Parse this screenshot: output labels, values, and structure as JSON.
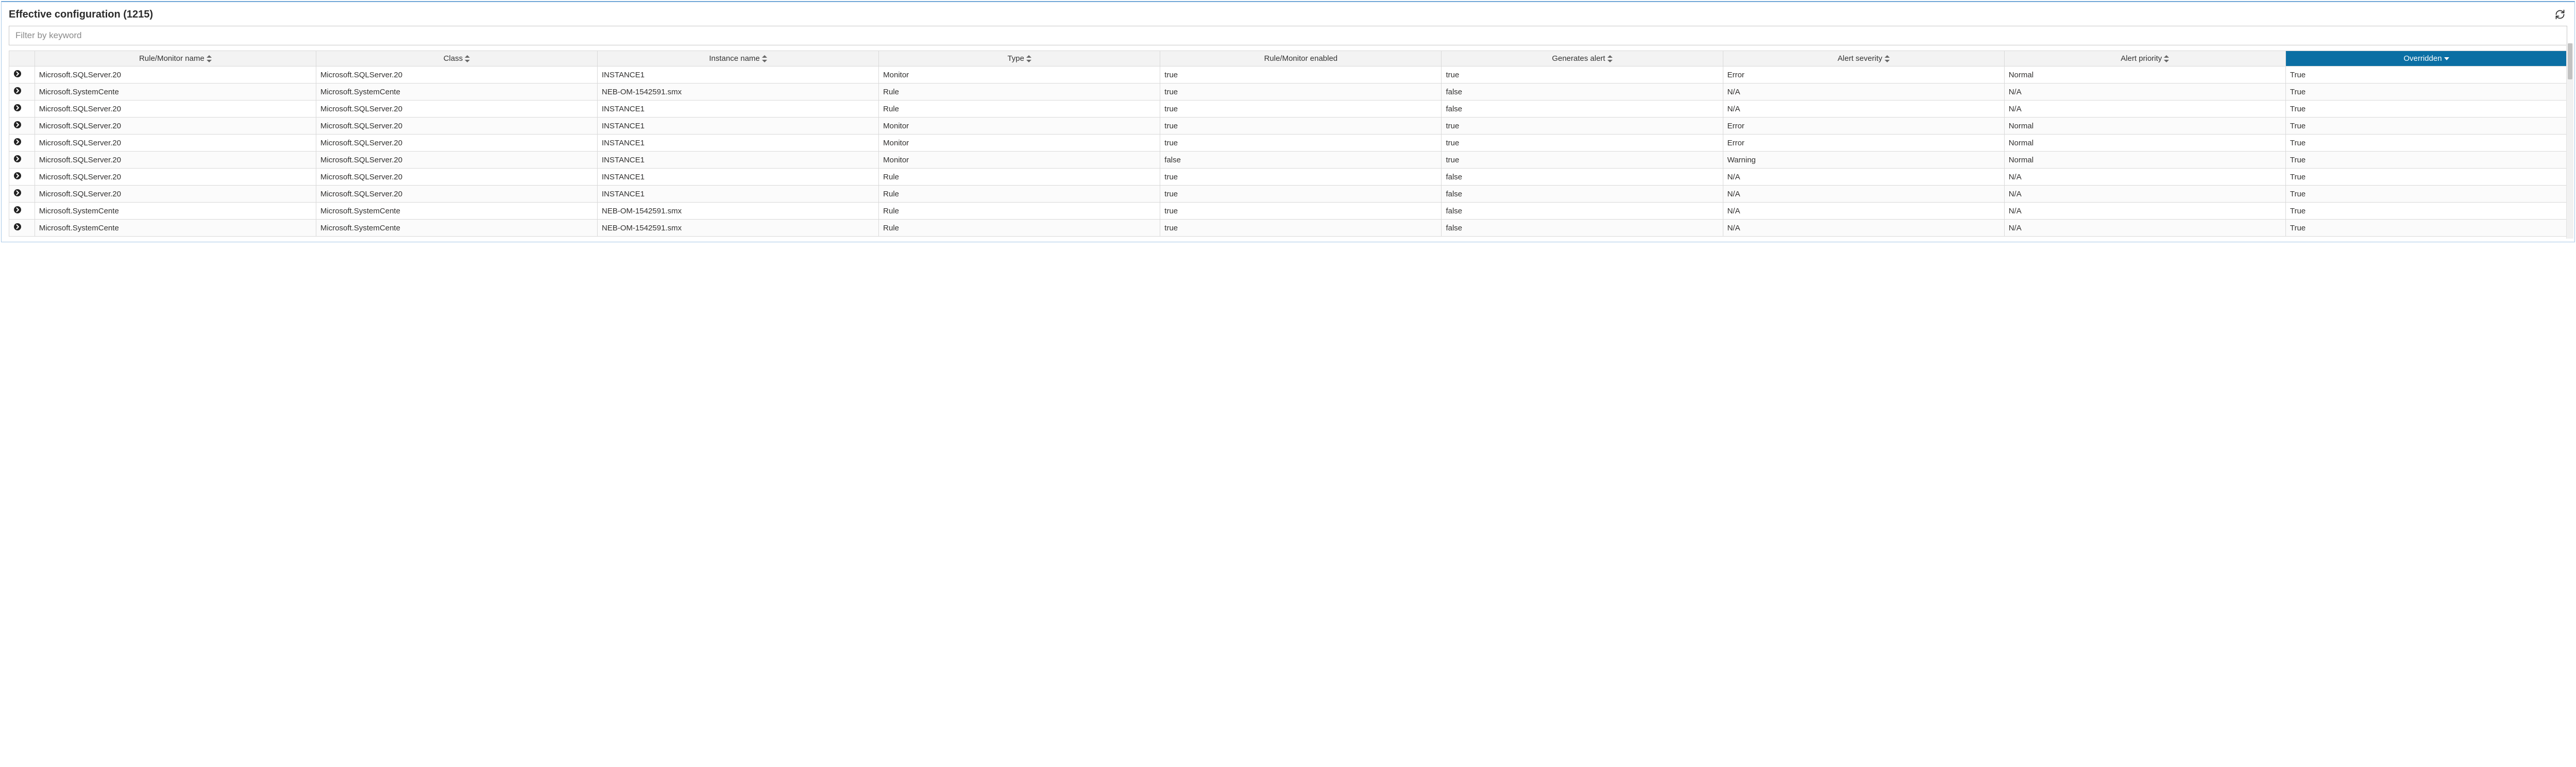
{
  "header": {
    "title": "Effective configuration (1215)"
  },
  "filter": {
    "placeholder": "Filter by keyword",
    "value": ""
  },
  "columns": [
    {
      "label": "",
      "sortable": false
    },
    {
      "label": "Rule/Monitor name",
      "sortable": true
    },
    {
      "label": "Class",
      "sortable": true
    },
    {
      "label": "Instance name",
      "sortable": true
    },
    {
      "label": "Type",
      "sortable": true
    },
    {
      "label": "Rule/Monitor enabled",
      "sortable": false
    },
    {
      "label": "Generates alert",
      "sortable": true
    },
    {
      "label": "Alert severity",
      "sortable": true
    },
    {
      "label": "Alert priority",
      "sortable": true
    },
    {
      "label": "Overridden",
      "sortable": true,
      "sorted": "desc"
    }
  ],
  "rows": [
    {
      "name": "Microsoft.SQLServer.20",
      "class": "Microsoft.SQLServer.20",
      "instance": "INSTANCE1",
      "type": "Monitor",
      "enabled": "true",
      "generates": "true",
      "severity": "Error",
      "priority": "Normal",
      "overridden": "True"
    },
    {
      "name": "Microsoft.SystemCente",
      "class": "Microsoft.SystemCente",
      "instance": "NEB-OM-1542591.smx",
      "type": "Rule",
      "enabled": "true",
      "generates": "false",
      "severity": "N/A",
      "priority": "N/A",
      "overridden": "True"
    },
    {
      "name": "Microsoft.SQLServer.20",
      "class": "Microsoft.SQLServer.20",
      "instance": "INSTANCE1",
      "type": "Rule",
      "enabled": "true",
      "generates": "false",
      "severity": "N/A",
      "priority": "N/A",
      "overridden": "True"
    },
    {
      "name": "Microsoft.SQLServer.20",
      "class": "Microsoft.SQLServer.20",
      "instance": "INSTANCE1",
      "type": "Monitor",
      "enabled": "true",
      "generates": "true",
      "severity": "Error",
      "priority": "Normal",
      "overridden": "True"
    },
    {
      "name": "Microsoft.SQLServer.20",
      "class": "Microsoft.SQLServer.20",
      "instance": "INSTANCE1",
      "type": "Monitor",
      "enabled": "true",
      "generates": "true",
      "severity": "Error",
      "priority": "Normal",
      "overridden": "True"
    },
    {
      "name": "Microsoft.SQLServer.20",
      "class": "Microsoft.SQLServer.20",
      "instance": "INSTANCE1",
      "type": "Monitor",
      "enabled": "false",
      "generates": "true",
      "severity": "Warning",
      "priority": "Normal",
      "overridden": "True"
    },
    {
      "name": "Microsoft.SQLServer.20",
      "class": "Microsoft.SQLServer.20",
      "instance": "INSTANCE1",
      "type": "Rule",
      "enabled": "true",
      "generates": "false",
      "severity": "N/A",
      "priority": "N/A",
      "overridden": "True"
    },
    {
      "name": "Microsoft.SQLServer.20",
      "class": "Microsoft.SQLServer.20",
      "instance": "INSTANCE1",
      "type": "Rule",
      "enabled": "true",
      "generates": "false",
      "severity": "N/A",
      "priority": "N/A",
      "overridden": "True"
    },
    {
      "name": "Microsoft.SystemCente",
      "class": "Microsoft.SystemCente",
      "instance": "NEB-OM-1542591.smx",
      "type": "Rule",
      "enabled": "true",
      "generates": "false",
      "severity": "N/A",
      "priority": "N/A",
      "overridden": "True"
    },
    {
      "name": "Microsoft.SystemCente",
      "class": "Microsoft.SystemCente",
      "instance": "NEB-OM-1542591.smx",
      "type": "Rule",
      "enabled": "true",
      "generates": "false",
      "severity": "N/A",
      "priority": "N/A",
      "overridden": "True"
    }
  ]
}
